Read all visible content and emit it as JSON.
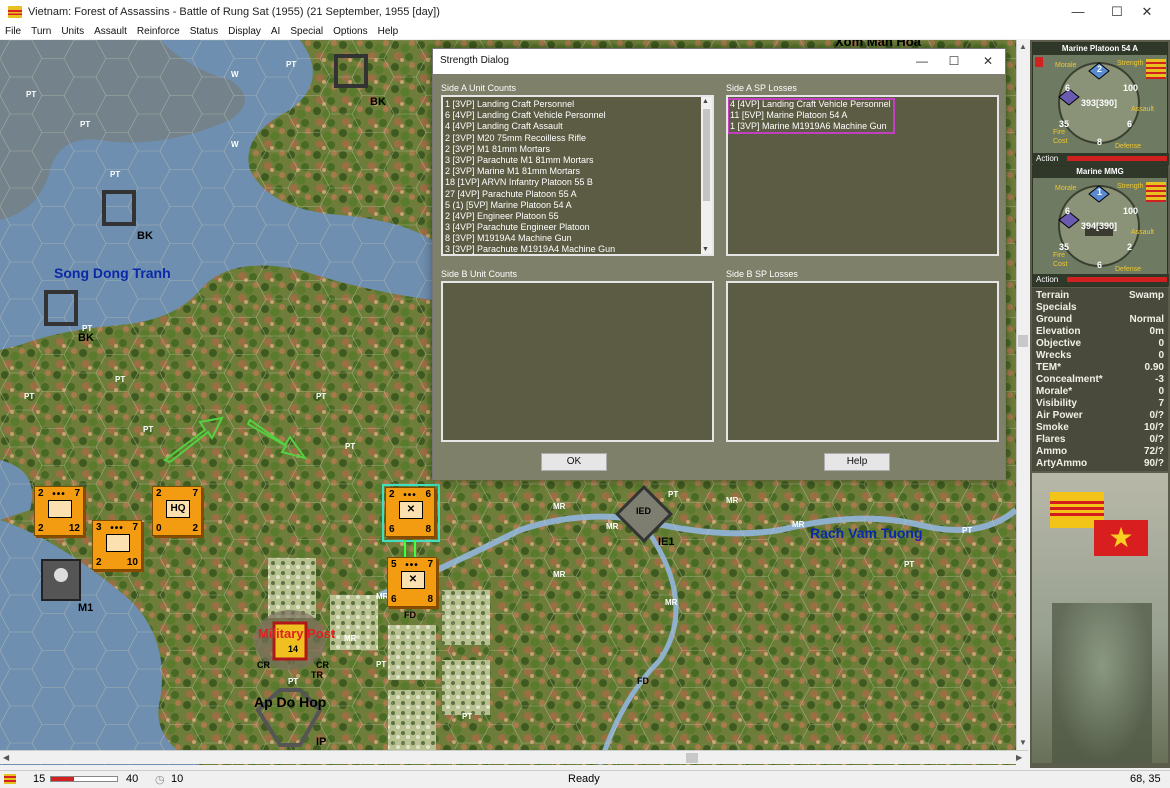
{
  "window": {
    "title": "Vietnam: Forest of Assassins - Battle of Rung Sat (1955) (21 September, 1955 [day])",
    "minimize": "—",
    "maximize": "☐",
    "close": "✕"
  },
  "menu": [
    "File",
    "Turn",
    "Units",
    "Assault",
    "Reinforce",
    "Status",
    "Display",
    "AI",
    "Special",
    "Options",
    "Help"
  ],
  "map_labels": {
    "song": "Song Dong Tranh",
    "rach": "Rach Vam Tuong",
    "military_post": "Military Post",
    "ap_do_hop": "Ap Do Hop",
    "xom": "Xom Man Hoa",
    "bk1": "BK",
    "bk2": "BK",
    "bk3": "BK",
    "m1": "M1",
    "ie1": "IE1",
    "fd1": "FD",
    "fd2": "FD",
    "ip": "IP",
    "post_value": "14",
    "ied": "IED",
    "pt": "PT",
    "mr": "MR",
    "cr": "CR",
    "tr": "TR",
    "w": "W"
  },
  "counters": [
    {
      "tl": "2",
      "tr": "7",
      "bl": "2",
      "br": "12",
      "sym": "⌂"
    },
    {
      "tl": "3",
      "tr": "7",
      "bl": "2",
      "br": "10",
      "sym": "⌂"
    },
    {
      "tl": "2",
      "tr": "7",
      "bl": "0",
      "br": "2",
      "sym": "HQ"
    },
    {
      "tl": "2",
      "tr": "6",
      "bl": "6",
      "br": "8",
      "sym": "✕"
    },
    {
      "tl": "5",
      "tr": "7",
      "bl": "6",
      "br": "8",
      "sym": "✕"
    }
  ],
  "dialog": {
    "title": "Strength Dialog",
    "side_a_counts_label": "Side A Unit Counts",
    "side_a_losses_label": "Side A SP Losses",
    "side_b_counts_label": "Side B Unit Counts",
    "side_b_losses_label": "Side B SP Losses",
    "side_a_counts": [
      "1 [3VP] Landing Craft Personnel",
      "6 [4VP] Landing Craft Vehicle Personnel",
      "4 [4VP] Landing Craft Assault",
      "2 [3VP] M20 75mm Recoilless Rifle",
      "2 [3VP] M1 81mm Mortars",
      "3 [3VP] Parachute M1 81mm Mortars",
      "2 [3VP] Marine M1 81mm Mortars",
      "18 [1VP] ARVN Infantry Platoon 55 B",
      "27 [4VP] Parachute Platoon 55 A",
      "5 (1) [5VP] Marine Platoon 54 A",
      "2 [4VP] Engineer Platoon 55",
      "3 [4VP] Parachute Engineer Platoon",
      "8 [3VP] M1919A4 Machine Gun",
      "3 [3VP] Parachute M1919A4 Machine Gun"
    ],
    "side_a_losses": [
      "4 [4VP] Landing Craft Vehicle Personnel",
      "11 [5VP] Marine Platoon 54 A",
      "1 [3VP] Marine M1919A6 Machine Gun"
    ],
    "ok_label": "OK",
    "help_label": "Help"
  },
  "unit_cards": [
    {
      "name": "Marine Platoon 54 A",
      "top_val": "2",
      "left_val": "6",
      "right_val": "100",
      "center": "393[390]",
      "bl_val": "35",
      "br_val": "6",
      "bottom_val": "8",
      "action": "Action"
    },
    {
      "name": "Marine MMG",
      "top_val": "1",
      "left_val": "6",
      "right_val": "100",
      "center": "394[390]",
      "bl_val": "35",
      "br_val": "2",
      "bottom_val": "6",
      "action": "Action"
    }
  ],
  "card_labels": {
    "morale": "Morale",
    "strength": "Strength",
    "assault": "Assault",
    "fire": "Fire",
    "cost": "Cost",
    "defense": "Defense"
  },
  "terrain_stats": [
    {
      "k": "Terrain",
      "v": "Swamp"
    },
    {
      "k": "Specials",
      "v": ""
    },
    {
      "k": "Ground",
      "v": "Normal"
    },
    {
      "k": "Elevation",
      "v": "0m"
    },
    {
      "k": "Objective",
      "v": "0"
    },
    {
      "k": "Wrecks",
      "v": "0"
    },
    {
      "k": "TEM*",
      "v": "0.90"
    },
    {
      "k": "Concealment*",
      "v": "-3"
    },
    {
      "k": "Morale*",
      "v": "0"
    },
    {
      "k": "Visibility",
      "v": "7"
    },
    {
      "k": "Air Power",
      "v": "0/?"
    },
    {
      "k": "Smoke",
      "v": "10/?"
    },
    {
      "k": "Flares",
      "v": "0/?"
    },
    {
      "k": "Ammo",
      "v": "72/?"
    },
    {
      "k": "ArtyAmmo",
      "v": "90/?"
    }
  ],
  "status": {
    "left_num": "15",
    "mid_num": "40",
    "right_num": "10",
    "ready": "Ready",
    "coords": "68, 35"
  },
  "colors": {
    "counter": "#f39c12",
    "dialog_bg": "#7e8069",
    "list_bg": "#5c5c44",
    "highlight": "#c040c0",
    "water": "#6f8fb0"
  }
}
